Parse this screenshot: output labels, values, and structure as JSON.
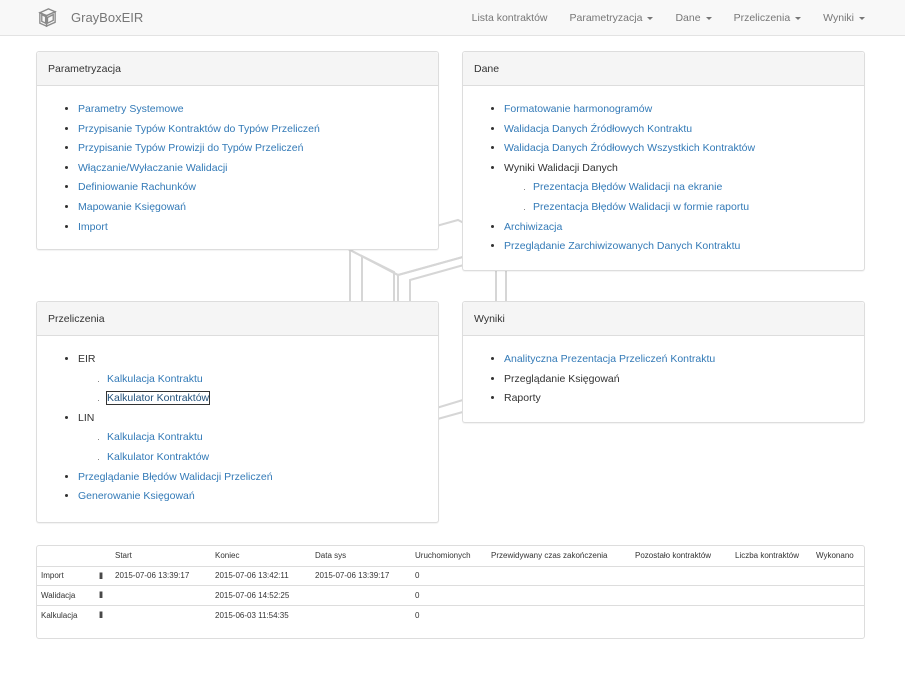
{
  "brand": {
    "title": "GrayBoxEIR"
  },
  "nav": {
    "items": [
      {
        "label": "Lista kontraktów",
        "dropdown": false
      },
      {
        "label": "Parametryzacja",
        "dropdown": true
      },
      {
        "label": "Dane",
        "dropdown": true
      },
      {
        "label": "Przeliczenia",
        "dropdown": true
      },
      {
        "label": "Wyniki",
        "dropdown": true
      }
    ]
  },
  "panels": {
    "parametryzacja": {
      "title": "Parametryzacja",
      "items": [
        "Parametry Systemowe",
        "Przypisanie Typów Kontraktów do Typów Przeliczeń",
        "Przypisanie Typów Prowizji do Typów Przeliczeń",
        "Włączanie/Wyłaczanie Walidacji",
        "Definiowanie Rachunków",
        "Mapowanie Księgowań",
        "Import"
      ]
    },
    "dane": {
      "title": "Dane",
      "items": [
        "Formatowanie harmonogramów",
        "Walidacja Danych Źródłowych Kontraktu",
        "Walidacja Danych Źródłowych Wszystkich Kontraktów"
      ],
      "wyniki_walidacji": {
        "label": "Wyniki Walidacji Danych",
        "items": [
          "Prezentacja Błędów Walidacji na ekranie",
          "Prezentacja Błędów Walidacji w formie raportu"
        ]
      },
      "items_after": [
        "Archiwizacja",
        "Przeglądanie Zarchiwizowanych Danych Kontraktu"
      ]
    },
    "przeliczenia": {
      "title": "Przeliczenia",
      "eir": {
        "label": "EIR",
        "items": [
          "Kalkulacja Kontraktu",
          "Kalkulator Kontraktów"
        ]
      },
      "lin": {
        "label": "LIN",
        "items": [
          "Kalkulacja Kontraktu",
          "Kalkulator Kontraktów"
        ]
      },
      "items": [
        "Przeglądanie Błędów Walidacji Przeliczeń",
        "Generowanie Księgowań"
      ]
    },
    "wyniki": {
      "title": "Wyniki",
      "link_item": "Analityczna Prezentacja Przeliczeń Kontraktu",
      "plain_items": [
        "Przeglądanie Księgowań",
        "Raporty"
      ]
    }
  },
  "status_table": {
    "headers": [
      "",
      "",
      "Start",
      "Koniec",
      "Data sys",
      "Uruchomionych",
      "Przewidywany czas zakończenia",
      "Pozostało kontraktów",
      "Liczba kontraktów",
      "Wykonano"
    ],
    "pause_glyph": "II",
    "rows": [
      {
        "name": "Import",
        "start": "2015-07-06 13:39:17",
        "koniec": "2015-07-06 13:42:11",
        "data_sys": "2015-07-06 13:39:17",
        "uruchomionych": "0",
        "przewidywany": "",
        "pozostalo": "",
        "liczba": "",
        "wykonano": ""
      },
      {
        "name": "Walidacja",
        "start": "",
        "koniec": "2015-07-06 14:52:25",
        "data_sys": "",
        "uruchomionych": "0",
        "przewidywany": "",
        "pozostalo": "",
        "liczba": "",
        "wykonano": ""
      },
      {
        "name": "Kalkulacja",
        "start": "",
        "koniec": "2015-06-03 11:54:35",
        "data_sys": "",
        "uruchomionych": "0",
        "przewidywany": "",
        "pozostalo": "",
        "liczba": "",
        "wykonano": ""
      }
    ]
  },
  "icons": {
    "brand": "cube-logo-icon",
    "watermark": "cube-watermark-icon",
    "dropdown": "caret-down-icon"
  },
  "colors": {
    "link": "#337ab7",
    "navbar_bg": "#f8f8f8",
    "panel_heading_bg": "#f5f5f5"
  }
}
